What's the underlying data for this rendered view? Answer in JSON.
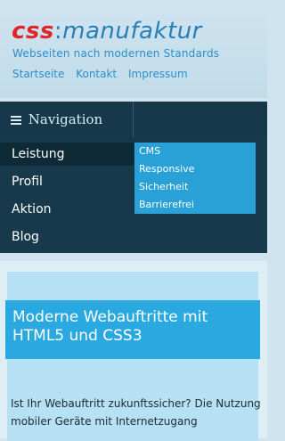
{
  "header": {
    "logo_css": "css",
    "logo_sep": ":",
    "logo_rest": "manufaktur",
    "tagline": "Webseiten nach modernen Standards",
    "links": [
      "Startseite",
      "Kontakt",
      "Impressum"
    ]
  },
  "nav": {
    "toggle_label": "Navigation",
    "items": [
      "Leistung",
      "Profil",
      "Aktion",
      "Blog"
    ],
    "submenu": [
      "CMS",
      "Responsive",
      "Sicherheit",
      "Barrierefrei"
    ]
  },
  "main": {
    "headline": "Moderne Webauftritte mit HTML5 und CSS3",
    "paragraph": "Ist Ihr Webauftritt zukunftssicher? Die Nutzung mobiler Geräte mit Internetzugang"
  }
}
